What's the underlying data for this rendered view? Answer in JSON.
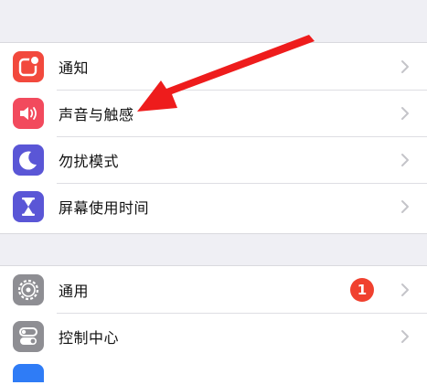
{
  "settings": {
    "group1": [
      {
        "label": "通知",
        "icon": "notifications-icon",
        "color": "#f2493d"
      },
      {
        "label": "声音与触感",
        "icon": "speaker-icon",
        "color": "#f24a5d"
      },
      {
        "label": "勿扰模式",
        "icon": "moon-icon",
        "color": "#5a56d6"
      },
      {
        "label": "屏幕使用时间",
        "icon": "hourglass-icon",
        "color": "#5a56d6"
      }
    ],
    "group2": [
      {
        "label": "通用",
        "icon": "gear-icon",
        "color": "#8e8e93",
        "badge": "1"
      },
      {
        "label": "控制中心",
        "icon": "switches-icon",
        "color": "#8e8e93"
      }
    ]
  },
  "annotation": {
    "arrow_color": "#ee1c1c"
  }
}
